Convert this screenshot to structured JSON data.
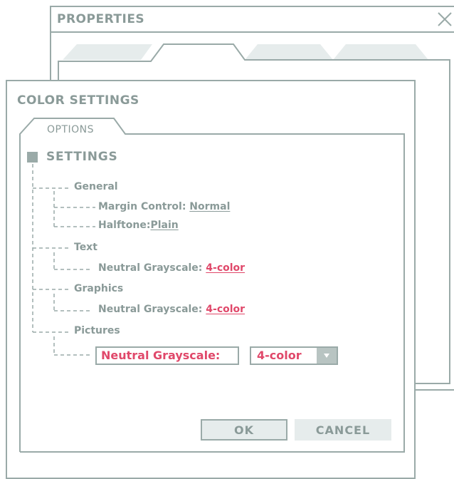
{
  "properties_window": {
    "title": "PROPERTIES",
    "close_icon": "close-icon"
  },
  "color_window": {
    "title": "COLOR SETTINGS",
    "tab_label": "OPTIONS",
    "section_label": "SETTINGS",
    "tree": {
      "general": {
        "label": "General",
        "margin_label": "Margin Control:",
        "margin_value": "Normal",
        "halftone_label": "Halftone:",
        "halftone_value": "Plain"
      },
      "text": {
        "label": "Text",
        "grayscale_label": "Neutral Grayscale:",
        "grayscale_value": "4-color"
      },
      "graphics": {
        "label": "Graphics",
        "grayscale_label": "Neutral Grayscale:",
        "grayscale_value": "4-color"
      },
      "pictures": {
        "label": "Pictures",
        "field_label": "Neutral Grayscale:",
        "select_value": "4-color",
        "select_icon": "chevron-down-icon"
      }
    },
    "buttons": {
      "ok": "OK",
      "cancel": "CANCEL"
    }
  },
  "colors": {
    "frame": "#9aaaa8",
    "text": "#8a9a98",
    "accent": "#e0486a",
    "button_fill": "#e6ecec"
  }
}
